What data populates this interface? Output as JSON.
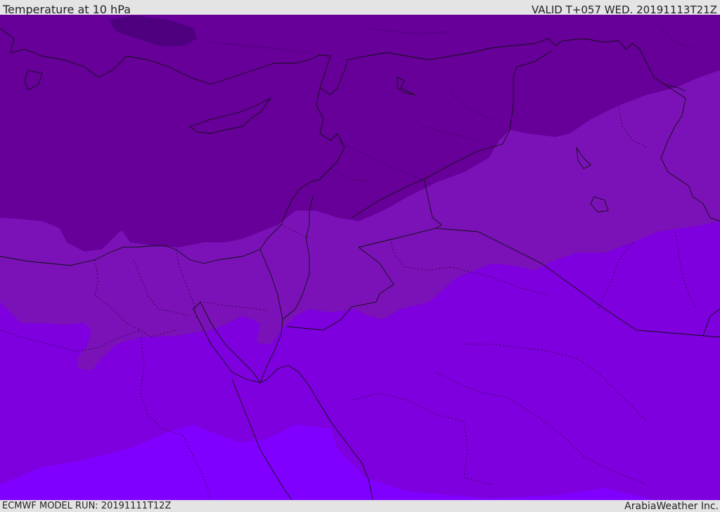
{
  "header": {
    "title": "Temperature at 10 hPa",
    "valid_time": "VALID T+057 WED. 20191113T21Z"
  },
  "footer": {
    "model_run": "ECMWF MODEL RUN: 20191111T12Z",
    "credit": "ArabiaWeather Inc."
  },
  "map": {
    "colors": {
      "band_darkest": "#4f007f",
      "band_dark": "#660099",
      "band_mid": "#7a12b7",
      "band_light": "#7e00de",
      "band_lightest": "#8000ff",
      "coastline": "#111111"
    }
  }
}
